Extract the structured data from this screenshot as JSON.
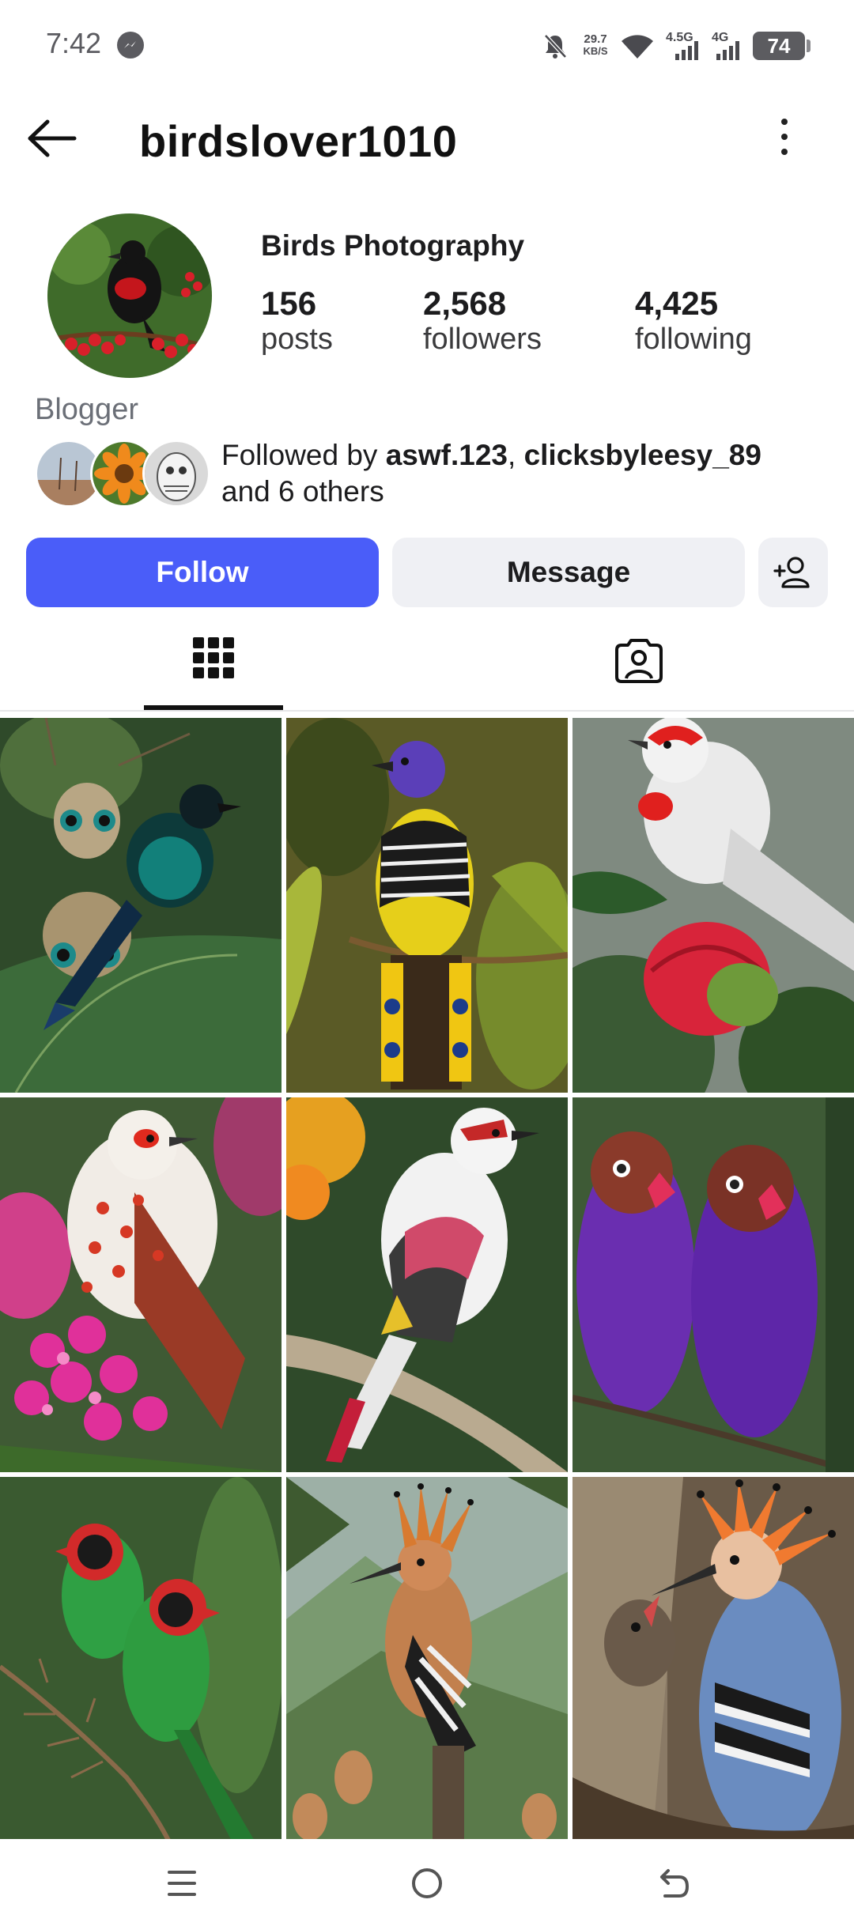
{
  "status_bar": {
    "time": "7:42",
    "speed_value": "29.7",
    "speed_unit": "KB/S",
    "net1": "4.5G",
    "net2": "4G",
    "battery": "74",
    "icons": [
      "messenger-icon",
      "bell-off-icon",
      "wifi-icon",
      "signal-icon",
      "battery-icon"
    ]
  },
  "header": {
    "username": "birdslover1010",
    "icons": [
      "back-arrow-icon",
      "more-vertical-icon"
    ]
  },
  "profile": {
    "display_name": "Birds Photography",
    "stats": [
      {
        "value": "156",
        "label": "posts"
      },
      {
        "value": "2,568",
        "label": "followers"
      },
      {
        "value": "4,425",
        "label": "following"
      }
    ],
    "bio": "Blogger",
    "followed_by": {
      "prefix": "Followed by ",
      "user1": "aswf.123",
      "separator": ", ",
      "user2": "clicksbyleesy_89",
      "suffix": "and 6 others"
    }
  },
  "actions": {
    "follow_label": "Follow",
    "message_label": "Message",
    "icons": [
      "add-user-icon"
    ]
  },
  "tabs": {
    "active": "grid",
    "icons": [
      "grid-icon",
      "tagged-icon"
    ]
  },
  "posts": [
    {
      "subject": "peacock-spider and blue bird on leaf"
    },
    {
      "subject": "violet and yellow barred bird"
    },
    {
      "subject": "white red-crowned bird on rose bud"
    },
    {
      "subject": "white red-spotted bird on pink flowers"
    },
    {
      "subject": "white pink-winged bird on branch"
    },
    {
      "subject": "two purple lovebirds"
    },
    {
      "subject": "two green red-faced finches"
    },
    {
      "subject": "hoopoe with chicks"
    },
    {
      "subject": "hoopoe feeding chick in tree"
    }
  ],
  "colors": {
    "accent": "#4a5df9",
    "secondary_button": "#eff0f4"
  },
  "nav_bar": {
    "icons": [
      "menu-icon",
      "home-circle-icon",
      "back-nav-icon"
    ]
  }
}
